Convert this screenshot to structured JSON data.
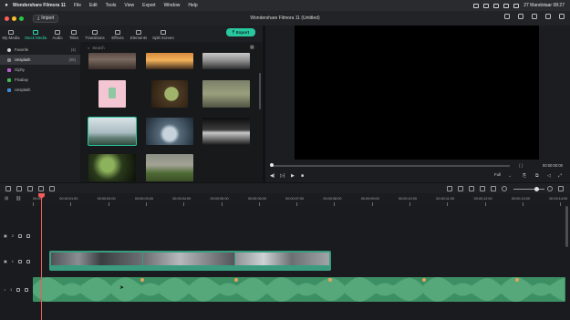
{
  "menubar": {
    "apple": "",
    "items": [
      "Wondershare Filmora 11",
      "File",
      "Edit",
      "Tools",
      "View",
      "Export",
      "Window",
      "Help"
    ],
    "clock": "27 Mandotaar 08:27"
  },
  "titlebar": {
    "import_label": "Import",
    "title": "Wondershare Filmora 11 (Untitled)"
  },
  "tabs": [
    {
      "label": "My Media",
      "icon": "folder-icon"
    },
    {
      "label": "Stock Media",
      "icon": "stock-icon",
      "active": true
    },
    {
      "label": "Audio",
      "icon": "music-icon"
    },
    {
      "label": "Titles",
      "icon": "text-icon"
    },
    {
      "label": "Transitions",
      "icon": "transition-icon"
    },
    {
      "label": "Effects",
      "icon": "effects-icon"
    },
    {
      "label": "Elements",
      "icon": "elements-icon"
    },
    {
      "label": "Split Screen",
      "icon": "split-screen-icon"
    }
  ],
  "export_label": "Export",
  "sidebar": {
    "items": [
      {
        "label": "Favorite",
        "count": "(4)"
      },
      {
        "label": "Unsplash",
        "count": "(25)",
        "active": true
      },
      {
        "label": "Giphy",
        "count": ""
      },
      {
        "label": "Pixabay",
        "count": ""
      },
      {
        "label": "Unsplash",
        "count": ""
      }
    ]
  },
  "browser": {
    "search_placeholder": "Search"
  },
  "preview": {
    "timecode": "00:00:00:00",
    "zoom": "Full"
  },
  "ruler": {
    "labels": [
      "00:00",
      "00:00:01:00",
      "00:00:02:00",
      "00:00:03:00",
      "00:00:04:00",
      "00:00:05:00",
      "00:00:06:00",
      "00:00:07:00",
      "00:00:08:00",
      "00:00:09:00",
      "00:00:10:00",
      "00:00:11:00",
      "00:00:12:00",
      "00:00:13:00",
      "00:00:14:00"
    ]
  },
  "tracks": [
    {
      "label": "2",
      "icon": "video-track-icon"
    },
    {
      "label": "1",
      "icon": "video-track-icon"
    },
    {
      "label": "1",
      "icon": "audio-track-icon"
    }
  ],
  "colors": {
    "accent": "#29c79f",
    "video_clip": "#3b9c7d",
    "audio_clip": "#3c8f63",
    "playhead": "#f05a5a"
  }
}
